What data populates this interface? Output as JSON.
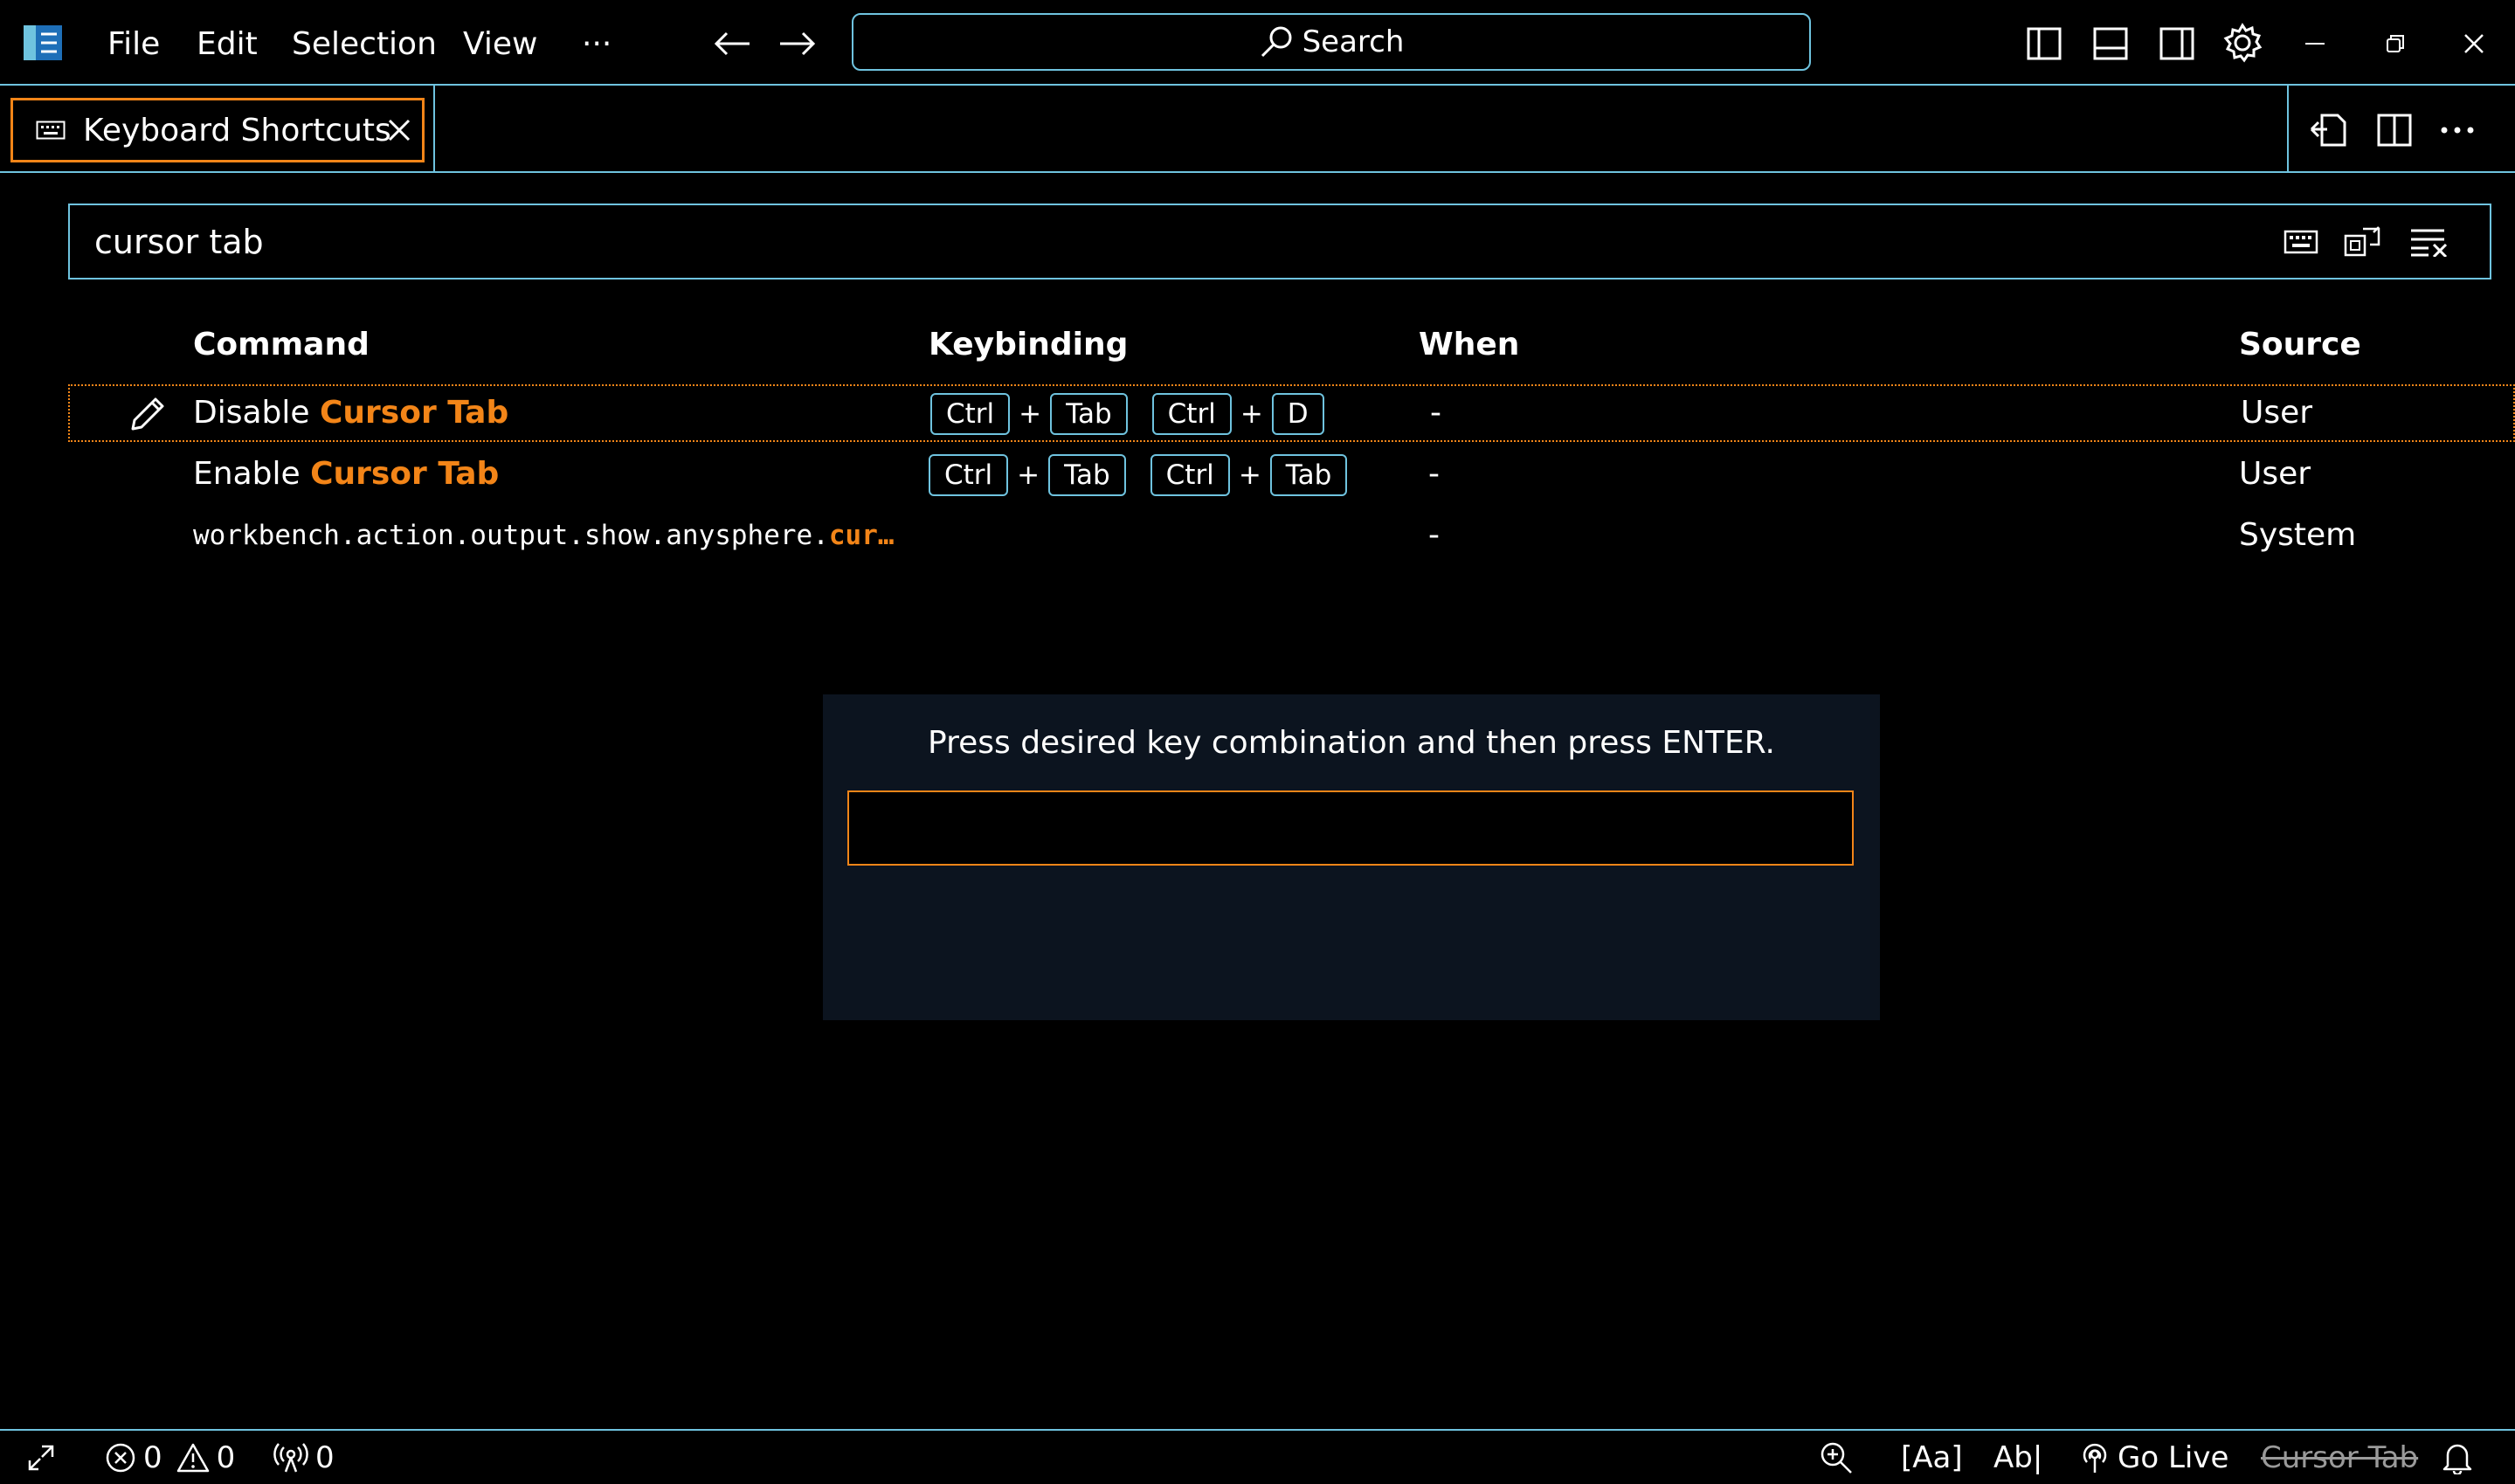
{
  "titlebar": {
    "menu": [
      "File",
      "Edit",
      "Selection",
      "View",
      "···"
    ],
    "search_label": "Search"
  },
  "tab": {
    "label": "Keyboard Shortcuts"
  },
  "kb_search": {
    "value": "cursor tab"
  },
  "table": {
    "headers": {
      "command": "Command",
      "keybinding": "Keybinding",
      "when": "When",
      "source": "Source"
    },
    "rows": [
      {
        "command_prefix": "Disable ",
        "command_highlight": "Cursor Tab",
        "keys": {
          "a1": "Ctrl",
          "a2": "Tab",
          "b1": "Ctrl",
          "b2": "D"
        },
        "when": "-",
        "source": "User"
      },
      {
        "command_prefix": "Enable ",
        "command_highlight": "Cursor Tab",
        "keys": {
          "a1": "Ctrl",
          "a2": "Tab",
          "b1": "Ctrl",
          "b2": "Tab"
        },
        "when": "-",
        "source": "User"
      },
      {
        "command_prefix": "workbench.action.output.show.anysphere.",
        "command_highlight": "cur…",
        "when": "-",
        "source": "System"
      }
    ],
    "plus": "+"
  },
  "dialog": {
    "message": "Press desired key combination and then press ENTER."
  },
  "statusbar": {
    "errors": "0",
    "warnings": "0",
    "ports": "0",
    "match_case": "[Aa]",
    "preserve_case": "Ab|",
    "go_live": "Go Live",
    "cursor_tab": "Cursor Tab"
  },
  "colors": {
    "accent": "#f38518",
    "border": "#6fc3df",
    "background": "#000000",
    "dialog_bg": "#0c141f"
  }
}
